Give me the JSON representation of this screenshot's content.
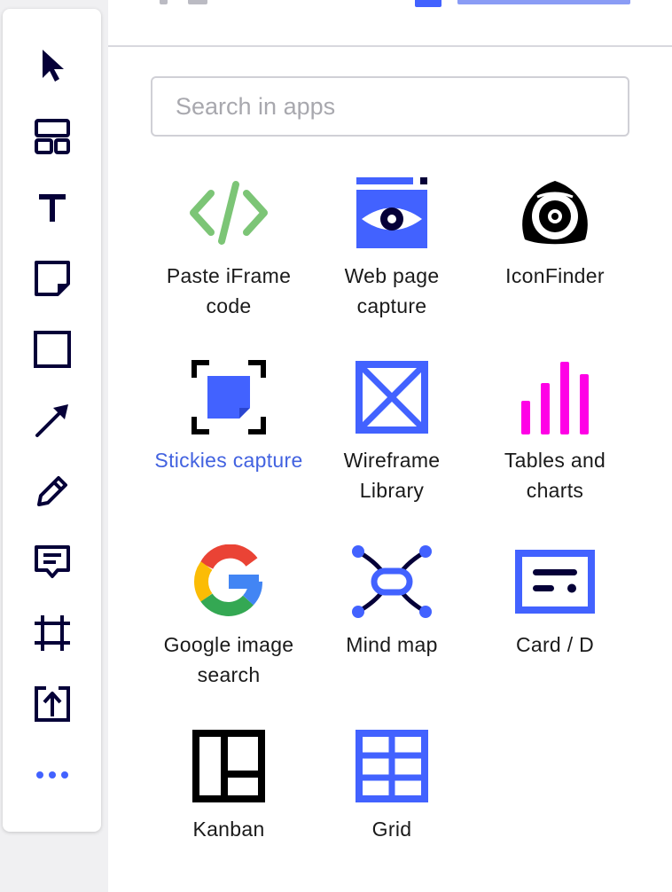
{
  "toolbar": {
    "tools": [
      {
        "name": "select-tool",
        "icon": "cursor-icon"
      },
      {
        "name": "templates-tool",
        "icon": "layout-icon"
      },
      {
        "name": "text-tool",
        "icon": "text-icon"
      },
      {
        "name": "sticky-note-tool",
        "icon": "sticky-note-icon"
      },
      {
        "name": "shape-tool",
        "icon": "square-icon"
      },
      {
        "name": "arrow-tool",
        "icon": "arrow-icon"
      },
      {
        "name": "pen-tool",
        "icon": "pencil-icon"
      },
      {
        "name": "comment-tool",
        "icon": "comment-icon"
      },
      {
        "name": "frame-tool",
        "icon": "frame-icon"
      },
      {
        "name": "upload-tool",
        "icon": "upload-icon"
      },
      {
        "name": "more-tools",
        "icon": "more-icon"
      }
    ]
  },
  "search": {
    "placeholder": "Search in apps"
  },
  "apps": [
    {
      "label": "Paste iFrame code",
      "icon": "code-icon",
      "active": false
    },
    {
      "label": "Web page capture",
      "icon": "eye-browser-icon",
      "active": false
    },
    {
      "label": "IconFinder",
      "icon": "iconfinder-logo-icon",
      "active": false
    },
    {
      "label": "Stickies capture",
      "icon": "stickies-capture-icon",
      "active": true
    },
    {
      "label": "Wireframe Library",
      "icon": "wireframe-icon",
      "active": false
    },
    {
      "label": "Tables and charts",
      "icon": "bar-chart-icon",
      "active": false
    },
    {
      "label": "Google image search",
      "icon": "google-logo-icon",
      "active": false
    },
    {
      "label": "Mind map",
      "icon": "mind-map-icon",
      "active": false
    },
    {
      "label": "Card / D",
      "icon": "card-icon",
      "active": false
    },
    {
      "label": "Kanban",
      "icon": "kanban-icon",
      "active": false
    },
    {
      "label": "Grid",
      "icon": "grid-icon",
      "active": false
    }
  ],
  "colors": {
    "toolbar_icon": "#050038",
    "accent_blue": "#4262ff",
    "active_label": "#4262e0",
    "iframe_green": "#7cc576",
    "chart_magenta": "#ff00e6"
  }
}
